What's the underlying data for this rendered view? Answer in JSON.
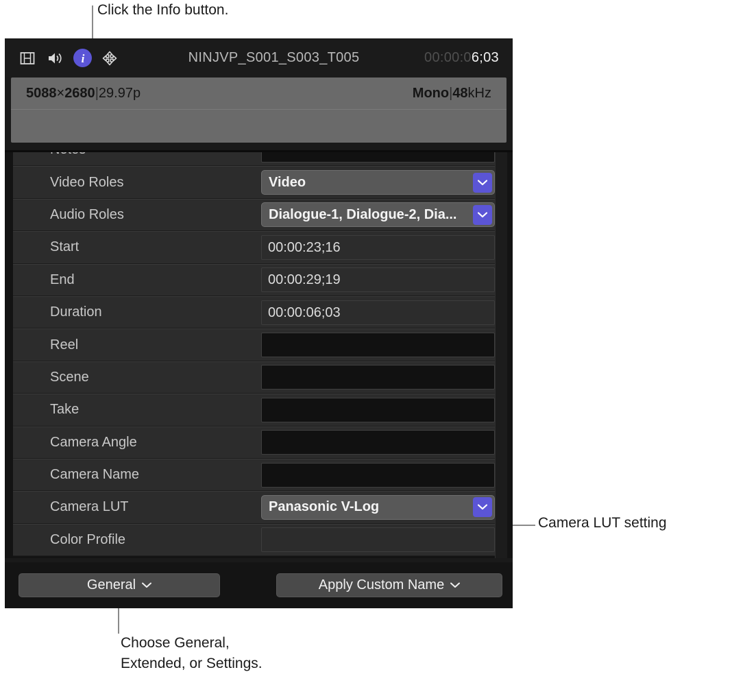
{
  "annotations": {
    "top": "Click the Info button.",
    "right": "Camera LUT setting",
    "bottom": "Choose General,\nExtended, or Settings."
  },
  "header": {
    "icons": [
      {
        "name": "film-strip-icon",
        "label": "video"
      },
      {
        "name": "speaker-icon",
        "label": "audio"
      },
      {
        "name": "info-icon",
        "label": "info",
        "active": true,
        "color": "#5b55d6"
      },
      {
        "name": "share-icon",
        "label": "share"
      }
    ],
    "clip_title": "NINJVP_S001_S003_T005",
    "timecode_dim": "00:00:0",
    "timecode_bright": "6;03"
  },
  "info_panel": {
    "video_width": "5088",
    "video_times": "×",
    "video_height": "2680",
    "video_sep": "|",
    "video_framerate": "29.97p",
    "audio_channels": "Mono",
    "audio_sep": "|",
    "audio_rate_num": "48",
    "audio_rate_unit": "kHz"
  },
  "properties": [
    {
      "label": "Notes",
      "type": "field",
      "value": ""
    },
    {
      "label": "Video Roles",
      "type": "popup",
      "value": "Video"
    },
    {
      "label": "Audio Roles",
      "type": "popup",
      "value": "Dialogue-1, Dialogue-2, Dia..."
    },
    {
      "label": "Start",
      "type": "plain",
      "value": "00:00:23;16"
    },
    {
      "label": "End",
      "type": "plain",
      "value": "00:00:29;19"
    },
    {
      "label": "Duration",
      "type": "plain",
      "value": "00:00:06;03"
    },
    {
      "label": "Reel",
      "type": "field",
      "value": ""
    },
    {
      "label": "Scene",
      "type": "field",
      "value": ""
    },
    {
      "label": "Take",
      "type": "field",
      "value": ""
    },
    {
      "label": "Camera Angle",
      "type": "field",
      "value": ""
    },
    {
      "label": "Camera Name",
      "type": "field",
      "value": ""
    },
    {
      "label": "Camera LUT",
      "type": "popup",
      "value": "Panasonic V-Log"
    },
    {
      "label": "Color Profile",
      "type": "plain",
      "value": ""
    }
  ],
  "toolbar": {
    "general_label": "General",
    "apply_name_label": "Apply Custom Name"
  },
  "colors": {
    "accent": "#5b55d6",
    "panel_grey": "#6a6a6a",
    "row_bg": "#2c2c2c"
  }
}
